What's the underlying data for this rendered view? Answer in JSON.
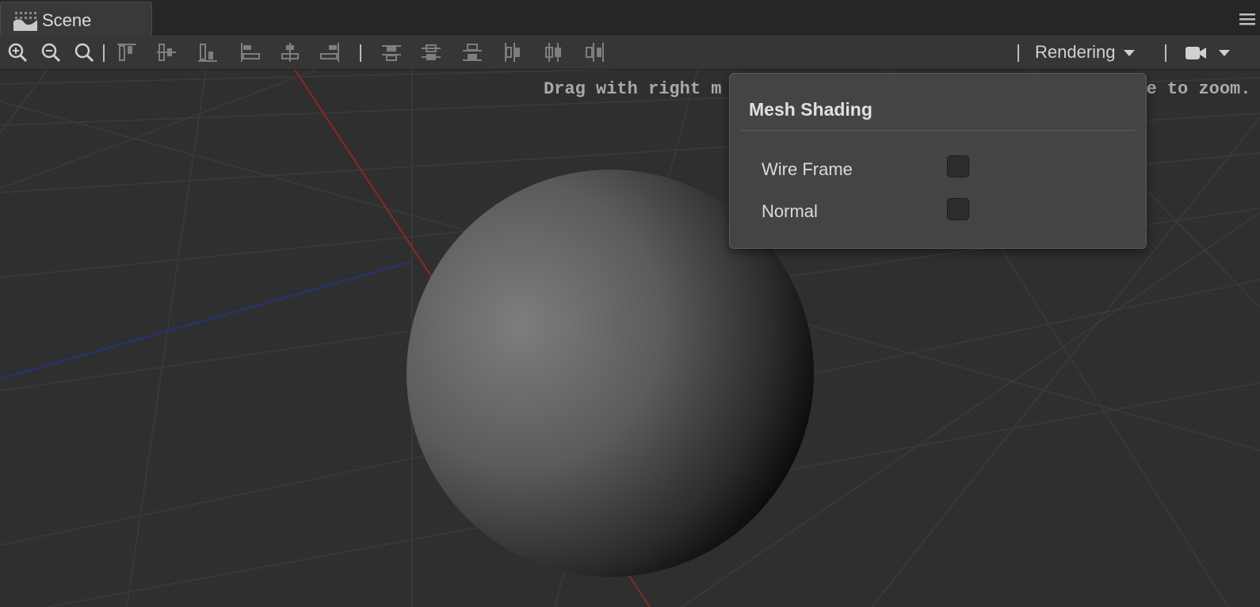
{
  "tab": {
    "title": "Scene",
    "icon": "scene-icon"
  },
  "window_menu": {
    "icon": "hamburger-menu-icon"
  },
  "toolbar": {
    "zoom_tools": [
      {
        "name": "zoom-in-icon"
      },
      {
        "name": "zoom-out-icon"
      },
      {
        "name": "zoom-reset-icon"
      }
    ],
    "align_tools": [
      {
        "name": "align-top-icon"
      },
      {
        "name": "align-vertical-center-icon"
      },
      {
        "name": "align-bottom-icon"
      },
      {
        "name": "align-left-icon"
      },
      {
        "name": "align-horizontal-center-icon"
      },
      {
        "name": "align-right-icon"
      }
    ],
    "distribute_tools": [
      {
        "name": "distribute-top-icon"
      },
      {
        "name": "distribute-vertical-center-icon"
      },
      {
        "name": "distribute-bottom-icon"
      },
      {
        "name": "distribute-left-icon"
      },
      {
        "name": "distribute-horizontal-center-icon"
      },
      {
        "name": "distribute-right-icon"
      }
    ],
    "rendering_label": "Rendering",
    "camera_icon": "camera-icon"
  },
  "viewport": {
    "hint_left": "Drag with right m",
    "hint_right": "e to zoom."
  },
  "popup": {
    "title": "Mesh Shading",
    "options": [
      {
        "label": "Wire Frame",
        "checked": false
      },
      {
        "label": "Normal",
        "checked": false
      }
    ]
  },
  "colors": {
    "background": "#2f2f2f",
    "x_axis": "#8a2a2a",
    "z_axis": "#27336b",
    "grid": "#3a3a3a"
  }
}
